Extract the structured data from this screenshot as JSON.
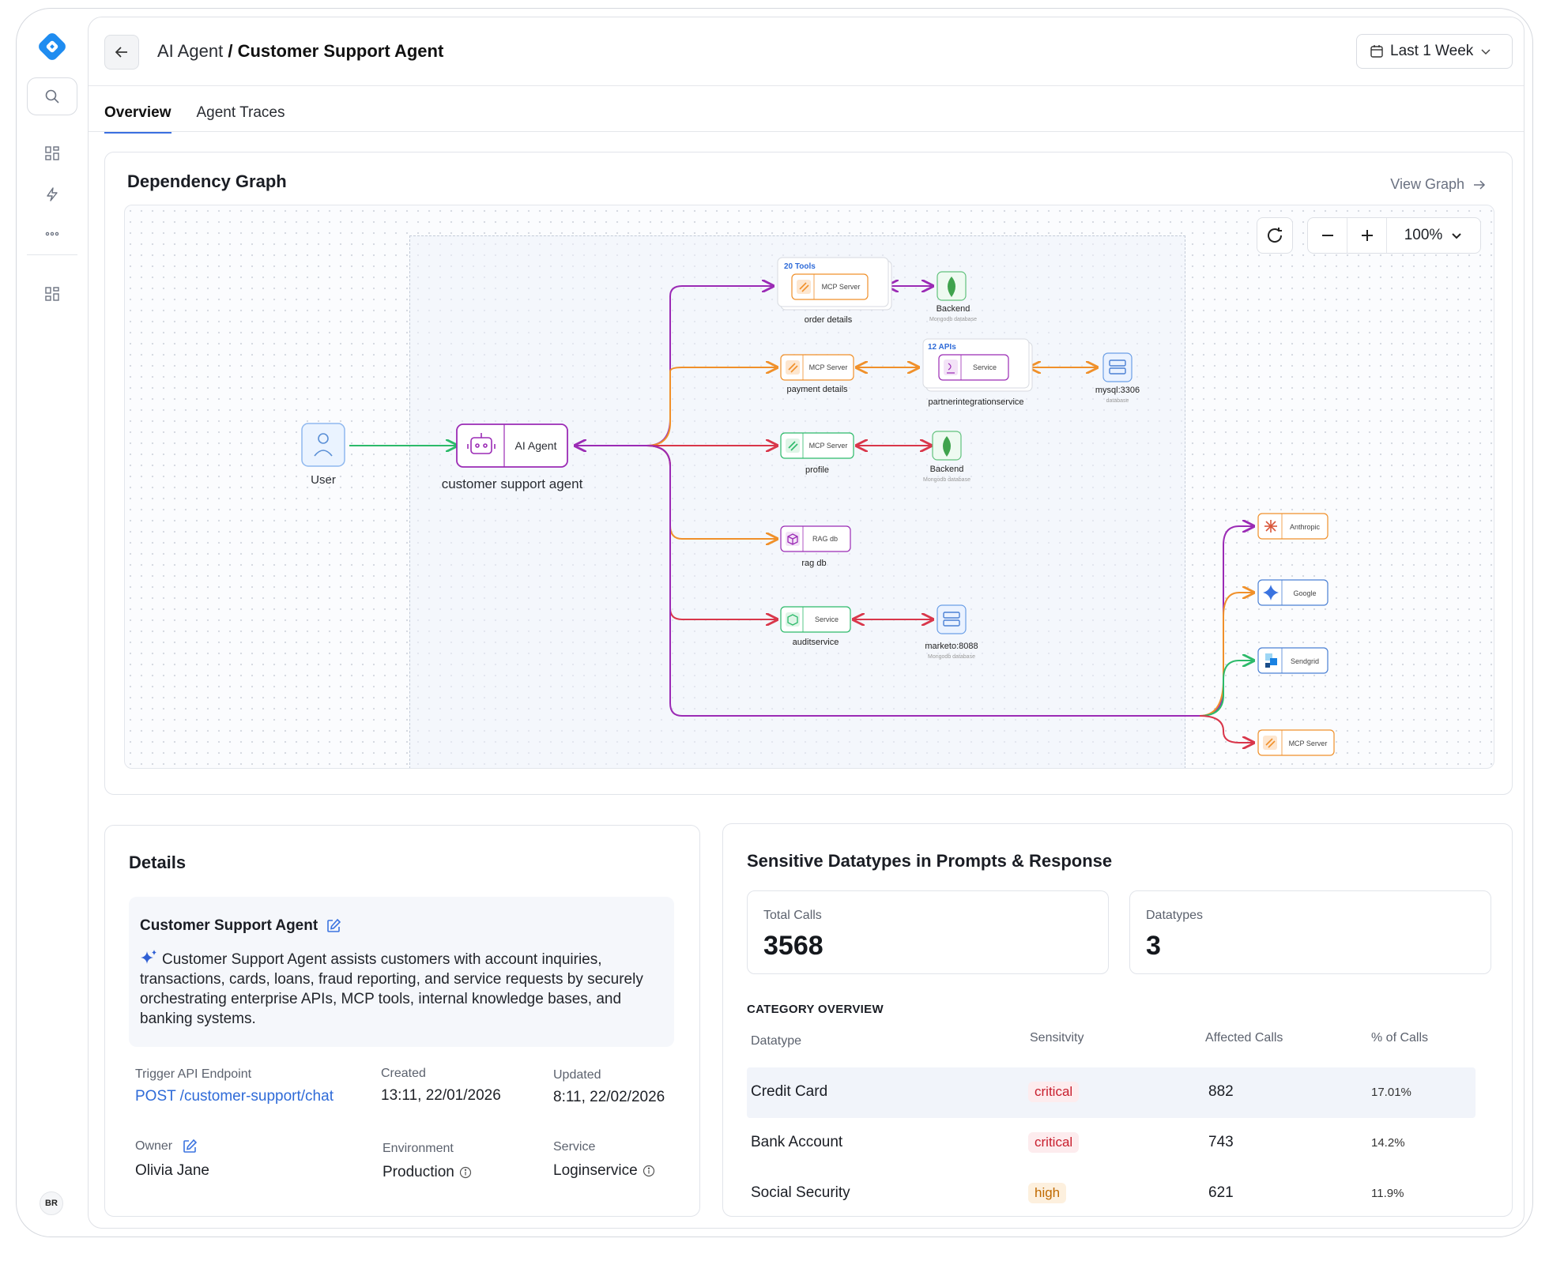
{
  "breadcrumb": {
    "parent": "AI Agent",
    "separator": "/",
    "current": "Customer Support Agent"
  },
  "date_filter": {
    "label": "Last 1 Week"
  },
  "tabs": [
    {
      "label": "Overview",
      "active": true
    },
    {
      "label": "Agent Traces",
      "active": false
    }
  ],
  "dependency_graph": {
    "title": "Dependency Graph",
    "view_link": "View Graph",
    "zoom": "100%",
    "nodes": {
      "user": {
        "label": "User"
      },
      "agent": {
        "type": "AI Agent",
        "label": "customer support agent"
      },
      "mcp_order": {
        "badge": "20 Tools",
        "type": "MCP Server",
        "label": "order details"
      },
      "backend1": {
        "label": "Backend",
        "sub": "Mongodb database"
      },
      "mcp_payment": {
        "type": "MCP Server",
        "label": "payment details"
      },
      "service_partner": {
        "badge": "12 APIs",
        "type": "Service",
        "label": "partnerintegrationservice"
      },
      "mysql": {
        "label": "mysql:3306",
        "sub": "database"
      },
      "mcp_profile": {
        "type": "MCP Server",
        "label": "profile"
      },
      "backend2": {
        "label": "Backend",
        "sub": "Mongodb database"
      },
      "ragdb": {
        "type": "RAG db",
        "label": "rag db"
      },
      "audit": {
        "type": "Service",
        "label": "auditservice"
      },
      "marketo": {
        "label": "marketo:8088",
        "sub": "Mongodb database"
      },
      "anthropic": {
        "type": "Anthropic"
      },
      "google": {
        "type": "Google"
      },
      "sendgrid": {
        "type": "Sendgrid"
      },
      "mcp_ext": {
        "type": "MCP Server"
      }
    },
    "colors": {
      "purple": "#9b2bb5",
      "orange": "#f0902a",
      "red": "#d9364a",
      "green": "#2cba6a"
    }
  },
  "details": {
    "title": "Details",
    "agent_name": "Customer Support Agent",
    "description": "Customer Support Agent assists customers with account inquiries, transactions, cards, loans, fraud reporting, and service requests by securely orchestrating enterprise APIs, MCP tools, internal knowledge bases, and banking systems.",
    "trigger_label": "Trigger API Endpoint",
    "trigger_value": "POST /customer-support/chat",
    "created_label": "Created",
    "created_value": "13:11, 22/01/2026",
    "updated_label": "Updated",
    "updated_value": "8:11, 22/02/2026",
    "owner_label": "Owner",
    "owner_value": "Olivia Jane",
    "env_label": "Environment",
    "env_value": "Production",
    "service_label": "Service",
    "service_value": "Loginservice"
  },
  "sensitive": {
    "title": "Sensitive Datatypes in Prompts & Response",
    "total_calls_label": "Total Calls",
    "total_calls": "3568",
    "datatypes_label": "Datatypes",
    "datatypes": "3",
    "category_overview": "CATEGORY OVERVIEW",
    "columns": [
      "Datatype",
      "Sensitvity",
      "Affected Calls",
      "% of Calls"
    ],
    "rows": [
      {
        "datatype": "Credit Card",
        "sensitivity": "critical",
        "calls": "882",
        "pct": "17.01%"
      },
      {
        "datatype": "Bank Account",
        "sensitivity": "critical",
        "calls": "743",
        "pct": "14.2%"
      },
      {
        "datatype": "Social Security",
        "sensitivity": "high",
        "calls": "621",
        "pct": "11.9%"
      }
    ]
  },
  "user_avatar": "BR"
}
